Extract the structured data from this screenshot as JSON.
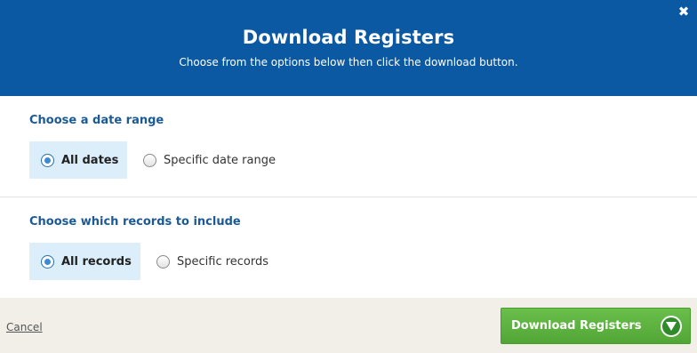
{
  "header": {
    "title": "Download Registers",
    "subtitle": "Choose from the options below then click the download button.",
    "close_icon": "close-icon"
  },
  "date_range": {
    "title": "Choose a date range",
    "options": [
      {
        "label": "All dates",
        "selected": true
      },
      {
        "label": "Specific date range",
        "selected": false
      }
    ]
  },
  "records": {
    "title": "Choose which records to include",
    "options": [
      {
        "label": "All records",
        "selected": true
      },
      {
        "label": "Specific records",
        "selected": false
      }
    ]
  },
  "footer": {
    "cancel_label": "Cancel",
    "download_label": "Download Registers",
    "download_icon": "chevron-down-icon"
  },
  "colors": {
    "header_bg": "#0b58a3",
    "section_title": "#1b5a95",
    "selected_bg": "#dbeefa",
    "download_button": "#5cb341",
    "footer_bg": "#f1efe8"
  }
}
